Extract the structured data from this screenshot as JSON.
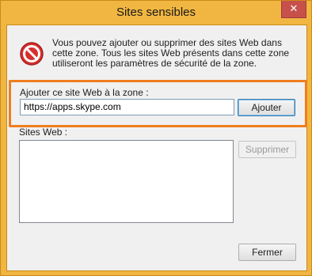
{
  "window": {
    "title": "Sites sensibles",
    "close_glyph": "✕"
  },
  "info": {
    "icon": "blocked-icon",
    "text": "Vous pouvez ajouter ou supprimer des sites Web dans cette zone. Tous les sites Web présents dans cette zone utiliseront les paramètres de sécurité de la zone."
  },
  "add_site": {
    "label": "Ajouter ce site Web à la zone :",
    "value": "https://apps.skype.com",
    "add_button": "Ajouter"
  },
  "sites": {
    "label": "Sites Web :",
    "items": [],
    "remove_button": "Supprimer"
  },
  "footer": {
    "close_button": "Fermer"
  },
  "colors": {
    "frame": "#f1b641",
    "highlight": "#ef7d1e",
    "close": "#c7504b"
  }
}
